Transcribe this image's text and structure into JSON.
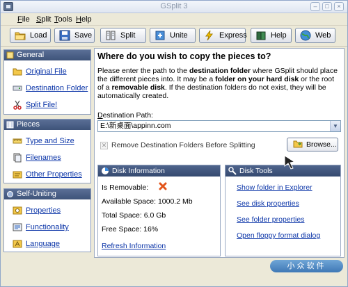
{
  "window": {
    "title": "GSplit 3"
  },
  "menu": [
    {
      "label": "File",
      "u": "F",
      "rest": "ile"
    },
    {
      "label": "Split",
      "u": "S",
      "rest": "plit"
    },
    {
      "label": "Tools",
      "u": "T",
      "rest": "ools"
    },
    {
      "label": "Help",
      "u": "H",
      "rest": "elp"
    }
  ],
  "toolbar": {
    "load": "Load",
    "save": "Save",
    "split": "Split",
    "unite": "Unite",
    "express": "Express",
    "help": "Help",
    "web": "Web"
  },
  "sidebar": {
    "general": {
      "title": "General",
      "items": [
        "Original File",
        "Destination Folder",
        "Split File!"
      ]
    },
    "pieces": {
      "title": "Pieces",
      "items": [
        "Type and Size",
        "Filenames",
        "Other Properties"
      ]
    },
    "self_uniting": {
      "title": "Self-Uniting",
      "items": [
        "Properties",
        "Functionality",
        "Language"
      ]
    }
  },
  "main": {
    "title": "Where do you wish to copy the pieces to?",
    "desc_1": "Please enter the path to the ",
    "desc_b1": "destination folder",
    "desc_2": " where GSplit should place the different pieces into. It may be a ",
    "desc_b2": "folder on your hard disk",
    "desc_3": " or the root of a ",
    "desc_b3": "removable disk",
    "desc_4": ". If the destination folders do not exist, they will be automatically created.",
    "path_label_u": "D",
    "path_label_rest": "estination Path:",
    "path_value": "E:\\新桌面\\appinn.com",
    "remove_checkbox_label": "Remove Destination Folders Before Splitting",
    "browse_label": "Browse..."
  },
  "disk_info": {
    "title": "Disk Information",
    "removable_label": "Is Removable:",
    "available": "Available Space: 1000.2 Mb",
    "total": "Total Space: 6.0 Gb",
    "free": "Free Space: 16%",
    "refresh": "Refresh Information"
  },
  "disk_tools": {
    "title": "Disk Tools",
    "links": [
      "Show folder in Explorer",
      "See disk properties",
      "See folder properties",
      "Open floppy format dialog"
    ]
  },
  "watermark": "小众软件",
  "colors": {
    "link": "#0b35a8",
    "header": "#3e5379",
    "cross": "#e2541a"
  }
}
